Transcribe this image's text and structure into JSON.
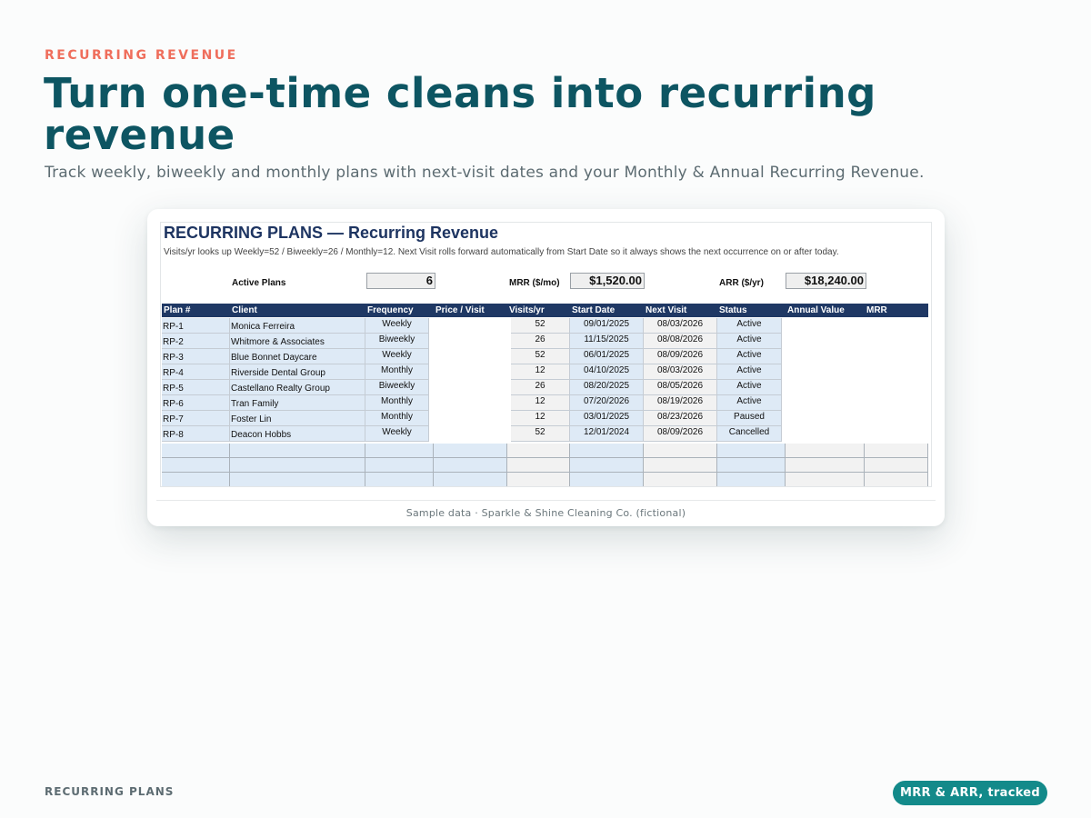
{
  "eyebrow": "RECURRING REVENUE",
  "headline": "Turn one-time cleans into recurring revenue",
  "subhead": "Track weekly, biweekly and monthly plans with next-visit dates and your Monthly & Annual Recurring Revenue.",
  "sheet": {
    "title": "RECURRING PLANS — Recurring Revenue",
    "note": "Visits/yr looks up Weekly=52 / Biweekly=26 / Monthly=12. Next Visit rolls forward automatically from Start Date so it always shows the next occurrence on or after today.",
    "kpis": {
      "active_label": "Active Plans",
      "active_value": "6",
      "mrr_label": "MRR ($/mo)",
      "mrr_value": "$1,520.00",
      "arr_label": "ARR ($/yr)",
      "arr_value": "$18,240.00"
    },
    "columns": [
      "Plan #",
      "Client",
      "Frequency",
      "Price / Visit",
      "Visits/yr",
      "Start Date",
      "Next Visit",
      "Status",
      "Annual Value",
      "MRR"
    ],
    "rows": [
      [
        "RP-1",
        "Monica Ferreira",
        "Weekly",
        "",
        "52",
        "09/01/2025",
        "08/03/2026",
        "Active",
        "",
        ""
      ],
      [
        "RP-2",
        "Whitmore & Associates",
        "Biweekly",
        "",
        "26",
        "11/15/2025",
        "08/08/2026",
        "Active",
        "",
        ""
      ],
      [
        "RP-3",
        "Blue Bonnet Daycare",
        "Weekly",
        "",
        "52",
        "06/01/2025",
        "08/09/2026",
        "Active",
        "",
        ""
      ],
      [
        "RP-4",
        "Riverside Dental Group",
        "Monthly",
        "",
        "12",
        "04/10/2025",
        "08/03/2026",
        "Active",
        "",
        ""
      ],
      [
        "RP-5",
        "Castellano Realty Group",
        "Biweekly",
        "",
        "26",
        "08/20/2025",
        "08/05/2026",
        "Active",
        "",
        ""
      ],
      [
        "RP-6",
        "Tran Family",
        "Monthly",
        "",
        "12",
        "07/20/2026",
        "08/19/2026",
        "Active",
        "",
        ""
      ],
      [
        "RP-7",
        "Foster Lin",
        "Monthly",
        "",
        "12",
        "03/01/2025",
        "08/23/2026",
        "Paused",
        "",
        ""
      ],
      [
        "RP-8",
        "Deacon Hobbs",
        "Weekly",
        "",
        "52",
        "12/01/2024",
        "08/09/2026",
        "Cancelled",
        "",
        ""
      ]
    ]
  },
  "caption": "Sample data · Sparkle & Shine Cleaning Co. (fictional)",
  "footer_left": "RECURRING PLANS",
  "footer_badge": "MRR & ARR, tracked",
  "colors": {
    "eyebrow": "#ef6e5c",
    "headline": "#0d5562",
    "sheet_header": "#1f3864",
    "input_cell": "#deeaf6",
    "badge": "#138a8a"
  }
}
